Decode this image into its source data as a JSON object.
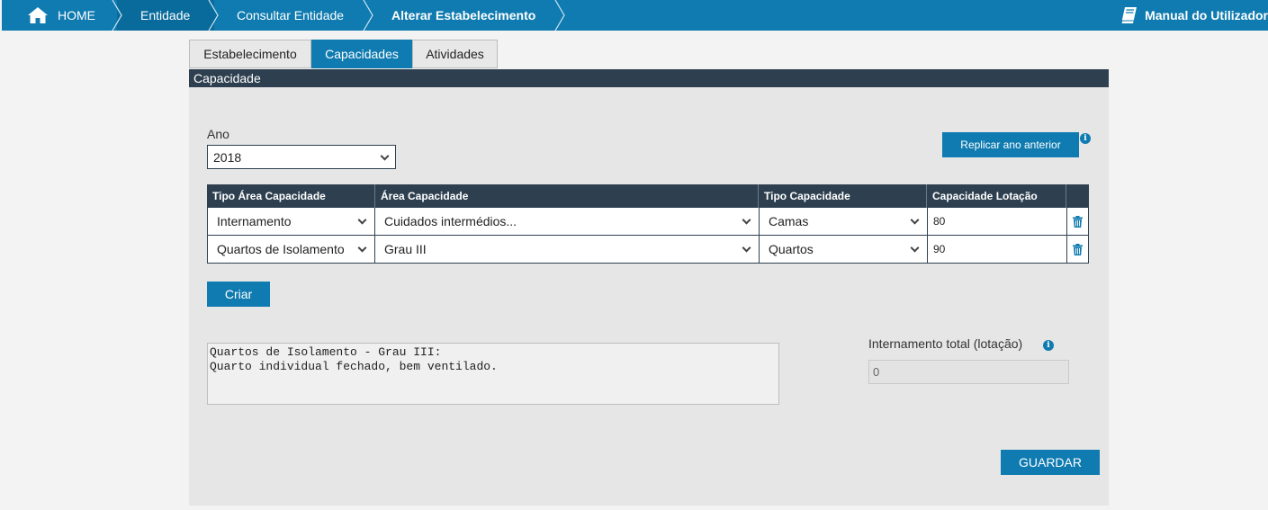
{
  "breadcrumb": {
    "home": "HOME",
    "entidade": "Entidade",
    "consultar": "Consultar Entidade",
    "alterar": "Alterar Estabelecimento"
  },
  "manual": "Manual do Utilizador",
  "tabs": [
    {
      "label": "Estabelecimento",
      "active": false
    },
    {
      "label": "Capacidades",
      "active": true
    },
    {
      "label": "Atividades",
      "active": false
    }
  ],
  "panel_title": "Capacidade",
  "ano": {
    "label": "Ano",
    "value": "2018"
  },
  "replicar_button": "Replicar ano anterior",
  "table": {
    "headers": [
      "Tipo Área Capacidade",
      "Área Capacidade",
      "Tipo Capacidade",
      "Capacidade Lotação"
    ],
    "rows": [
      {
        "tipo_area": "Internamento",
        "area": "Cuidados intermédios...",
        "tipo_capacidade": "Camas",
        "lotacao": "80"
      },
      {
        "tipo_area": "Quartos de Isolamento",
        "area": "Grau III",
        "tipo_capacidade": "Quartos",
        "lotacao": "90"
      }
    ]
  },
  "criar_button": "Criar",
  "description": {
    "line1": "Quartos de Isolamento - Grau III:",
    "line2": "Quarto individual fechado, bem ventilado."
  },
  "internamento_total": {
    "label": "Internamento total (lotação)",
    "value": "0"
  },
  "guardar_button": "GUARDAR",
  "colors": {
    "primary": "#0f7bb0",
    "header_dark": "#2e4050",
    "panel_bg": "#e6e6e6"
  }
}
